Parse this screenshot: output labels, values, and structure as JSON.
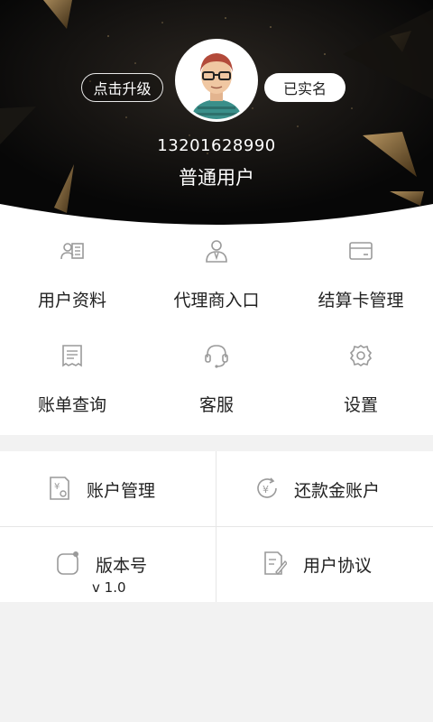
{
  "header": {
    "upgrade_label": "点击升级",
    "verified_label": "已实名",
    "phone": "13201628990",
    "user_level": "普通用户"
  },
  "grid": {
    "items": [
      {
        "label": "用户资料",
        "icon": "user-card-icon"
      },
      {
        "label": "代理商入口",
        "icon": "agent-icon"
      },
      {
        "label": "结算卡管理",
        "icon": "bank-card-icon"
      },
      {
        "label": "账单查询",
        "icon": "receipt-icon"
      },
      {
        "label": "客服",
        "icon": "headset-icon"
      },
      {
        "label": "设置",
        "icon": "gear-icon"
      }
    ]
  },
  "list": {
    "account": {
      "label": "账户管理",
      "icon": "account-settings-icon"
    },
    "repay": {
      "label": "还款金账户",
      "icon": "yen-refresh-icon"
    },
    "version": {
      "label": "版本号",
      "value": "v 1.0",
      "icon": "version-icon"
    },
    "agreement": {
      "label": "用户协议",
      "icon": "document-edit-icon"
    }
  },
  "colors": {
    "header_bg": "#0c0c0c",
    "gold": "#8a6a3c",
    "page_bg": "#f2f2f2",
    "icon_gray": "#9a9a9a"
  }
}
